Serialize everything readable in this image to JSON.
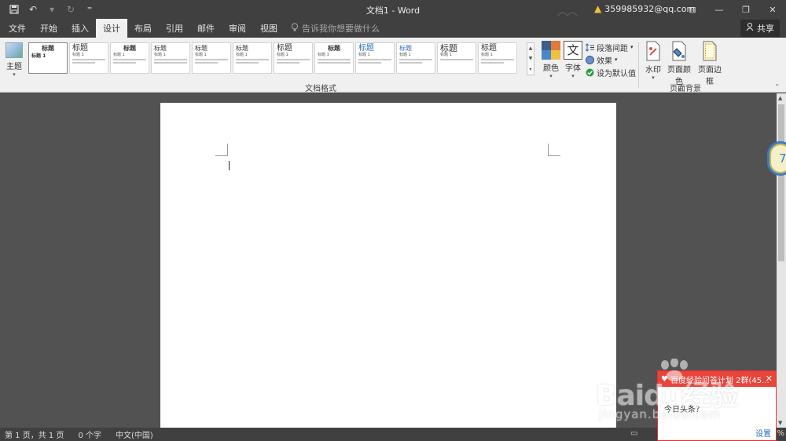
{
  "window": {
    "title": "文档1 - Word",
    "account": "359985932@qq.com"
  },
  "tabs": [
    {
      "label": "文件",
      "active": false
    },
    {
      "label": "开始",
      "active": false
    },
    {
      "label": "插入",
      "active": false
    },
    {
      "label": "设计",
      "active": true
    },
    {
      "label": "布局",
      "active": false
    },
    {
      "label": "引用",
      "active": false
    },
    {
      "label": "邮件",
      "active": false
    },
    {
      "label": "审阅",
      "active": false
    },
    {
      "label": "视图",
      "active": false
    }
  ],
  "tell_me": {
    "placeholder": "告诉我你想要做什么"
  },
  "share": {
    "label": "共享"
  },
  "ribbon": {
    "theme_label": "主题",
    "style_gallery": [
      {
        "heading": "标题",
        "subheading": "标题 1"
      },
      {
        "heading": "标题",
        "subheading": "标题 1"
      },
      {
        "heading": "标题",
        "subheading": "标题 1"
      },
      {
        "heading": "标题",
        "subheading": "标题 1"
      },
      {
        "heading": "标题",
        "subheading": "标题 1"
      },
      {
        "heading": "标题",
        "subheading": "标题 1"
      },
      {
        "heading": "标题",
        "subheading": "标题 1"
      },
      {
        "heading": "标题",
        "subheading": "标题 1"
      },
      {
        "heading": "标题",
        "subheading": "标题 1"
      },
      {
        "heading": "标题",
        "subheading": "标题 1"
      },
      {
        "heading": "标题",
        "subheading": "标题 1"
      },
      {
        "heading": "标题",
        "subheading": "标题 1"
      }
    ],
    "colors_label": "颜色",
    "fonts_label": "字体",
    "fonts_glyph": "文",
    "paragraph_spacing_label": "段落间距",
    "effects_label": "效果",
    "set_default_label": "设为默认值",
    "doc_format_group": "文档格式",
    "watermark_label": "水印",
    "page_color_label": "页面颜色",
    "page_border_label": "页面边框",
    "page_bg_group": "页面背景"
  },
  "side_badge": "7",
  "statusbar": {
    "page": "第 1 页，共 1 页",
    "words": "0 个字",
    "language": "中文(中国)",
    "zoom_tail": "%"
  },
  "popup": {
    "header": "百度经验问答计划 2群(45...",
    "body": "今日头条？",
    "footer": "设置"
  },
  "watermark": {
    "brand": "Baidu经验",
    "url": "jingyan.baidu.com"
  },
  "colors": {
    "chrome": "#404040",
    "ribbon": "#f0f0f0",
    "canvas": "#525252",
    "popup_red": "#e8443a"
  }
}
